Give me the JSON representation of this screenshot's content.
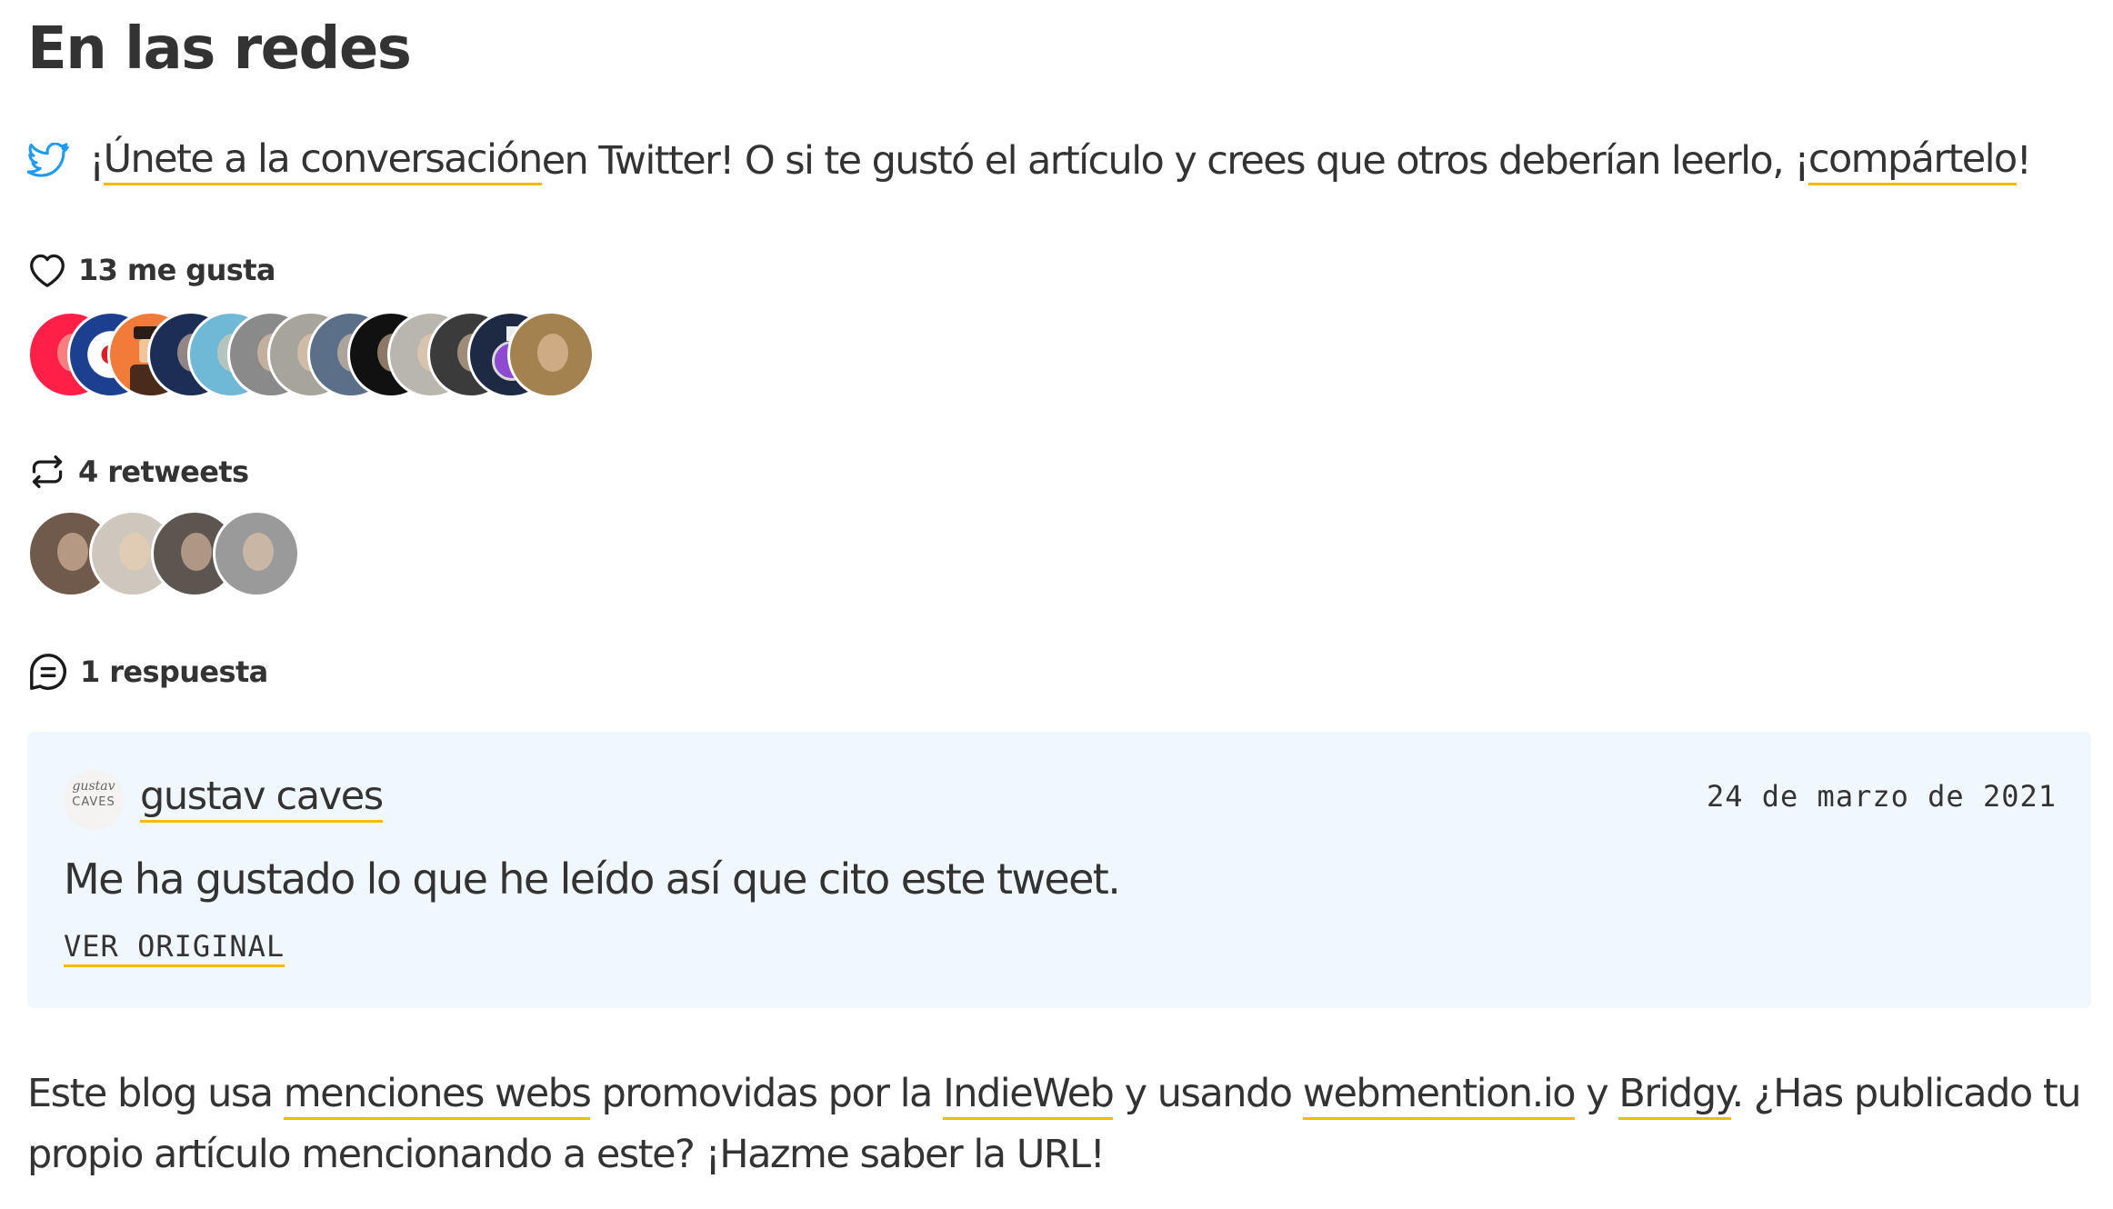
{
  "section": {
    "title": "En las redes"
  },
  "intro": {
    "prefix": "¡",
    "join_link": "Únete a la conversación",
    "middle": " en Twitter! O si te gustó el artículo y crees que otros deberían leerlo, ¡",
    "share_link": "compártelo",
    "suffix": "!"
  },
  "likes": {
    "label": "13 me gusta",
    "icon": "heart-icon",
    "avatars": [
      {
        "name": "like-avatar-1",
        "bg": "#ff1f47"
      },
      {
        "name": "like-avatar-2",
        "bg": "#1d3f8f",
        "style": "roundel"
      },
      {
        "name": "like-avatar-3",
        "bg": "#f27b3a",
        "style": "hat"
      },
      {
        "name": "like-avatar-4",
        "bg": "#1d2e56"
      },
      {
        "name": "like-avatar-5",
        "bg": "#6fb9d6"
      },
      {
        "name": "like-avatar-6",
        "bg": "#8a8a8a"
      },
      {
        "name": "like-avatar-7",
        "bg": "#a6a49b"
      },
      {
        "name": "like-avatar-8",
        "bg": "#5b6f88"
      },
      {
        "name": "like-avatar-9",
        "bg": "#111111"
      },
      {
        "name": "like-avatar-10",
        "bg": "#b9b6ae"
      },
      {
        "name": "like-avatar-11",
        "bg": "#3b3b3b"
      },
      {
        "name": "like-avatar-12",
        "bg": "#1e2a44",
        "style": "potion"
      },
      {
        "name": "like-avatar-13",
        "bg": "#a4824f"
      }
    ]
  },
  "retweets": {
    "label": "4 retweets",
    "icon": "retweet-icon",
    "avatars": [
      {
        "name": "retweet-avatar-1",
        "bg": "#6f5a4c"
      },
      {
        "name": "retweet-avatar-2",
        "bg": "#cdc7bd"
      },
      {
        "name": "retweet-avatar-3",
        "bg": "#5d5650"
      },
      {
        "name": "retweet-avatar-4",
        "bg": "#9a9a9a"
      }
    ]
  },
  "replies": {
    "label": "1 respuesta",
    "icon": "comment-icon",
    "items": [
      {
        "author": "gustav caves",
        "avatar_text_1": "gustav",
        "avatar_text_2": "CAVES",
        "date": "24 de marzo de 2021",
        "text": "Me ha gustado lo que he leído así que cito este tweet.",
        "link": "VER ORIGINAL"
      }
    ]
  },
  "footer": {
    "t1": "Este blog usa ",
    "l1": "menciones webs",
    "t2": " promovidas por la ",
    "l2": "IndieWeb",
    "t3": " y usando ",
    "l3": "webmention.io",
    "t4": " y ",
    "l4": "Bridgy",
    "t5": ". ¿Has publicado tu propio artículo mencionando a este? ¡Hazme saber la URL!"
  },
  "colors": {
    "accent_underline": "#f5bb00",
    "twitter_blue": "#1d9bf0",
    "reply_bg": "#f0f7fd",
    "text": "#333333"
  }
}
